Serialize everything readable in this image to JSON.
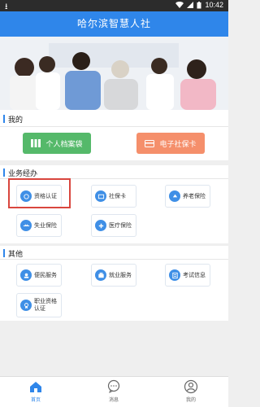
{
  "status": {
    "time": "10:42"
  },
  "header": {
    "title": "哈尔滨智慧人社"
  },
  "my": {
    "title": "我的",
    "buttons": {
      "personal_archive": "个人档案袋",
      "e_social_card": "电子社保卡"
    }
  },
  "business": {
    "title": "业务经办",
    "tiles": [
      "资格认证",
      "社保卡",
      "养老保险",
      "失业保险",
      "医疗保险"
    ]
  },
  "other": {
    "title": "其他",
    "tiles": [
      "便民服务",
      "就业服务",
      "考试信息"
    ],
    "qualification": {
      "line1": "职业资格",
      "line2": "认证"
    }
  },
  "bottom_nav": {
    "home": "首页",
    "messages": "消息",
    "mine": "我的"
  },
  "colors": {
    "accent": "#2f86ea",
    "green": "#55b96a",
    "orange": "#f58f6b",
    "highlight": "#d9463e"
  }
}
